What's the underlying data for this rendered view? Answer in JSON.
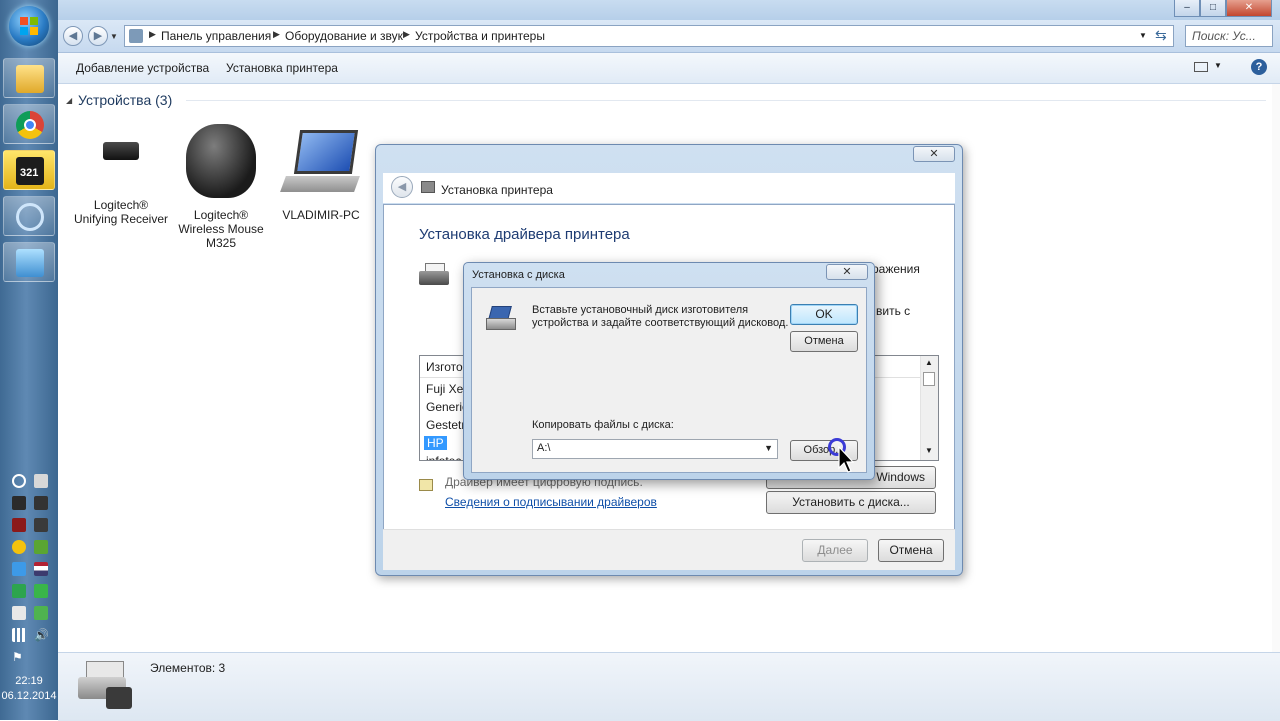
{
  "taskbar": {
    "clock_time": "22:19",
    "clock_date": "06.12.2014"
  },
  "window": {
    "caption_buttons": {
      "minimize": "–",
      "maximize": "□",
      "close": "✕"
    }
  },
  "address": {
    "breadcrumbs": [
      "Панель управления",
      "Оборудование и звук",
      "Устройства и принтеры"
    ],
    "search_placeholder": "Поиск: Ус..."
  },
  "toolbar": {
    "add_device": "Добавление устройства",
    "add_printer": "Установка принтера"
  },
  "devices": {
    "group_header": "Устройства (3)",
    "items": [
      {
        "name": "Logitech® Unifying Receiver"
      },
      {
        "name": "Logitech® Wireless Mouse M325"
      },
      {
        "name": "VLADIMIR-PC"
      }
    ]
  },
  "statusbar": {
    "count": "Элементов: 3"
  },
  "wizard": {
    "title": "Установка принтера",
    "heading": "Установка драйвера принтера",
    "partial_text_1": "ражения",
    "partial_text_2": "вить с",
    "list_header": "Изготов",
    "manufacturers": [
      "Fuji Xere",
      "Generic",
      "Gestetn",
      "HP",
      "infotec"
    ],
    "selected_manufacturer": "HP",
    "windows_update_btn": "Windows",
    "have_disk_btn": "Установить с диска...",
    "signed_note": "Драйвер имеет цифровую подпись.",
    "signing_link": "Сведения о подписывании драйверов",
    "next_btn": "Далее",
    "cancel_btn": "Отмена"
  },
  "disk_dialog": {
    "title": "Установка с диска",
    "message": "Вставьте установочный диск изготовителя устройства и задайте соответствующий дисковод.",
    "ok_btn": "OK",
    "cancel_btn": "Отмена",
    "copy_label": "Копировать файлы с диска:",
    "path_value": "A:\\",
    "browse_btn": "Обзор..."
  },
  "colors": {
    "link": "#0f4fa8",
    "heading": "#1e3c73",
    "selection": "#3399ff"
  }
}
